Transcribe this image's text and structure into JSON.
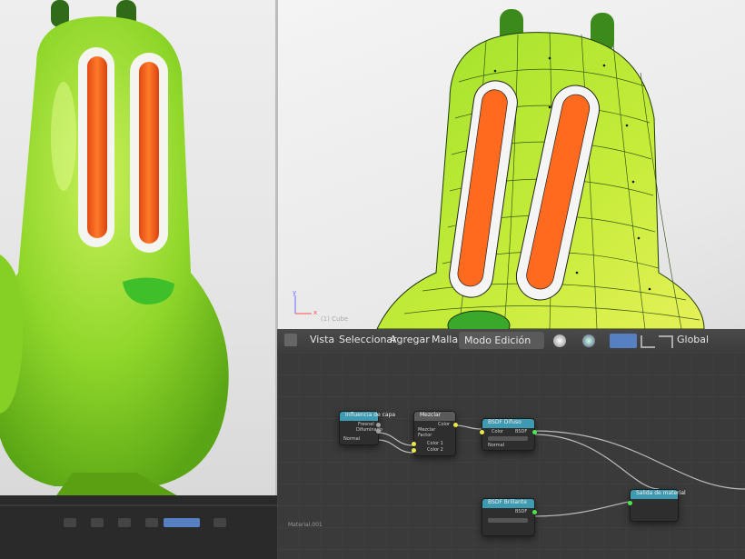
{
  "viewport": {
    "object_label": "(1) Cube",
    "axis_x": "x",
    "axis_y": "y"
  },
  "menu": {
    "items": [
      "Vista",
      "Seleccionar",
      "Agregar",
      "Malla"
    ],
    "mode_label": "Modo Edición",
    "orientation_label": "Global"
  },
  "nodes": {
    "layer_weight": {
      "title": "Influencia de capa",
      "rows": [
        "Fresnel",
        "Difuminado",
        "Normal"
      ]
    },
    "mix": {
      "title": "Mezclar",
      "rows": [
        "Color",
        "Mezclar",
        "Factor",
        "Color 1",
        "Color 2"
      ]
    },
    "bsdf_top": {
      "title": "BSDF Difuso",
      "rows": [
        "BSDF",
        "Color",
        "Normal"
      ]
    },
    "bsdf_bottom": {
      "title": "BSDF Brillante",
      "rows": [
        "BSDF"
      ]
    },
    "output": {
      "title": "Salida de material"
    }
  },
  "editor": {
    "material_label": "Material.001"
  },
  "colors": {
    "character_green": "#9fe12a",
    "eye_orange": "#ff6a1f",
    "node_header_blue": "#3d9ab0",
    "node_header_dark": "#5a5a5a"
  }
}
